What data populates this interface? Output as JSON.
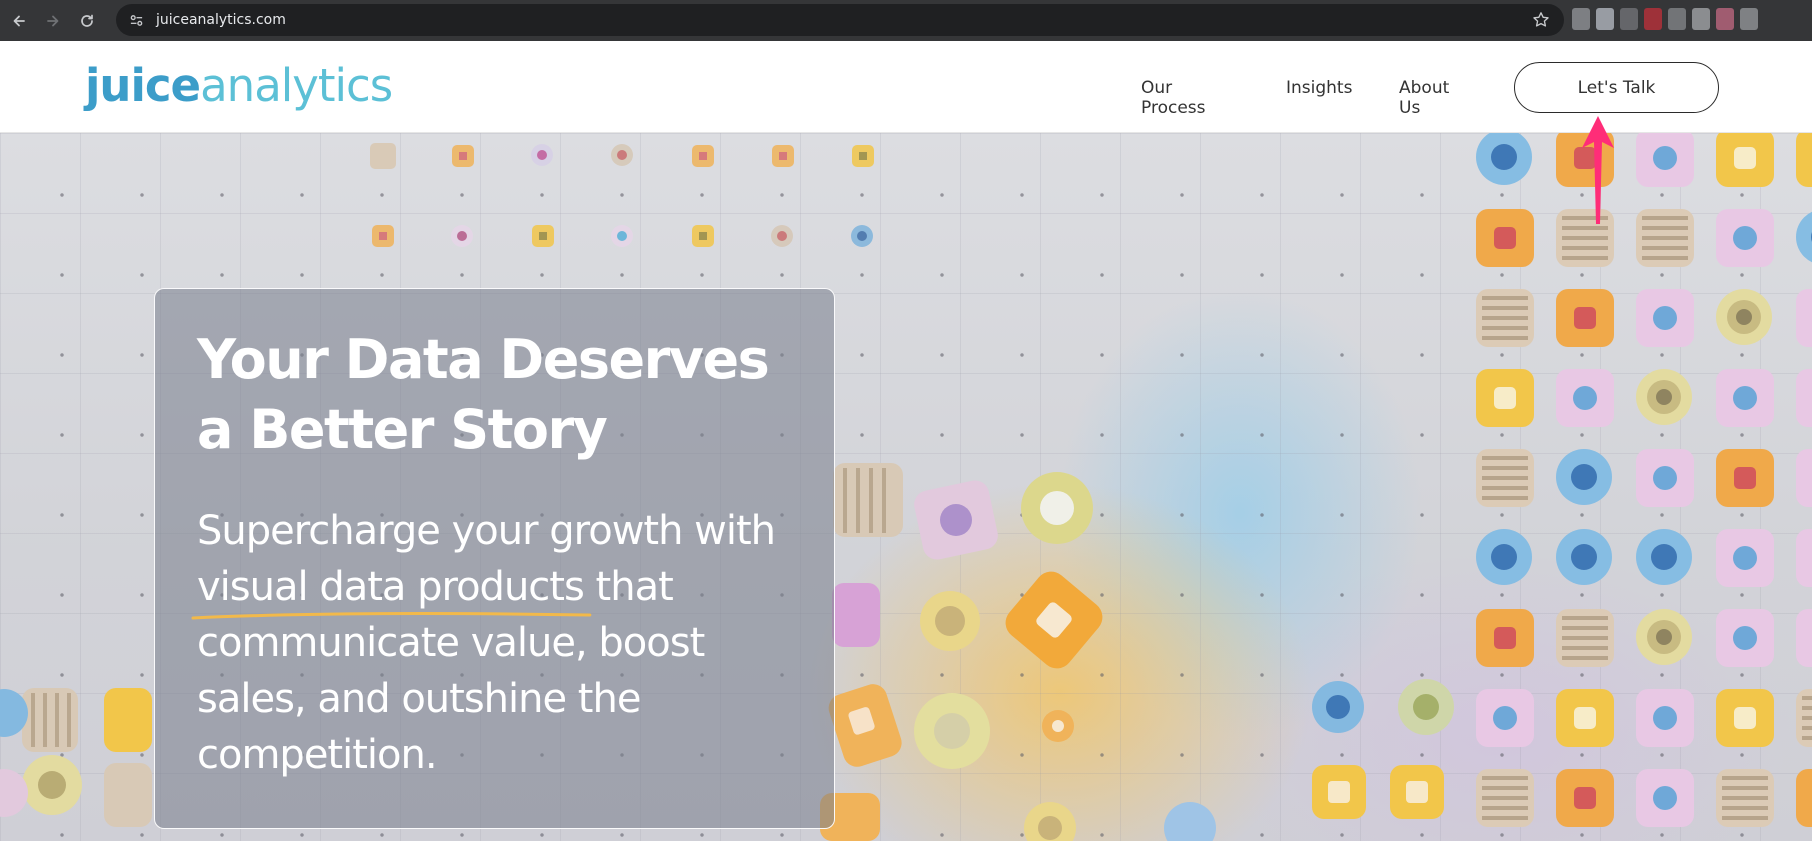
{
  "browser": {
    "url": "juiceanalytics.com"
  },
  "header": {
    "logo_primary": "juice",
    "logo_secondary": "analytics",
    "nav": {
      "our_process": "Our Process",
      "insights": "Insights",
      "about_us": "About Us"
    },
    "cta_label": "Let's Talk"
  },
  "hero": {
    "title": "Your Data Deserves a Better Story",
    "subtitle_part1": "Supercharge your growth with ",
    "subtitle_highlight": "visual data products",
    "subtitle_part2": " that communicate value, boost sales, and outshine the competition."
  },
  "colors": {
    "logo_dark": "#3c9dc9",
    "logo_light": "#5cc0d6",
    "highlight_underline": "#f2b94a",
    "annotation_arrow": "#ff2d78"
  },
  "icons": [
    "back-icon",
    "forward-icon",
    "reload-icon",
    "site-info-icon",
    "bookmark-star-icon",
    "annotation-arrow-icon"
  ]
}
